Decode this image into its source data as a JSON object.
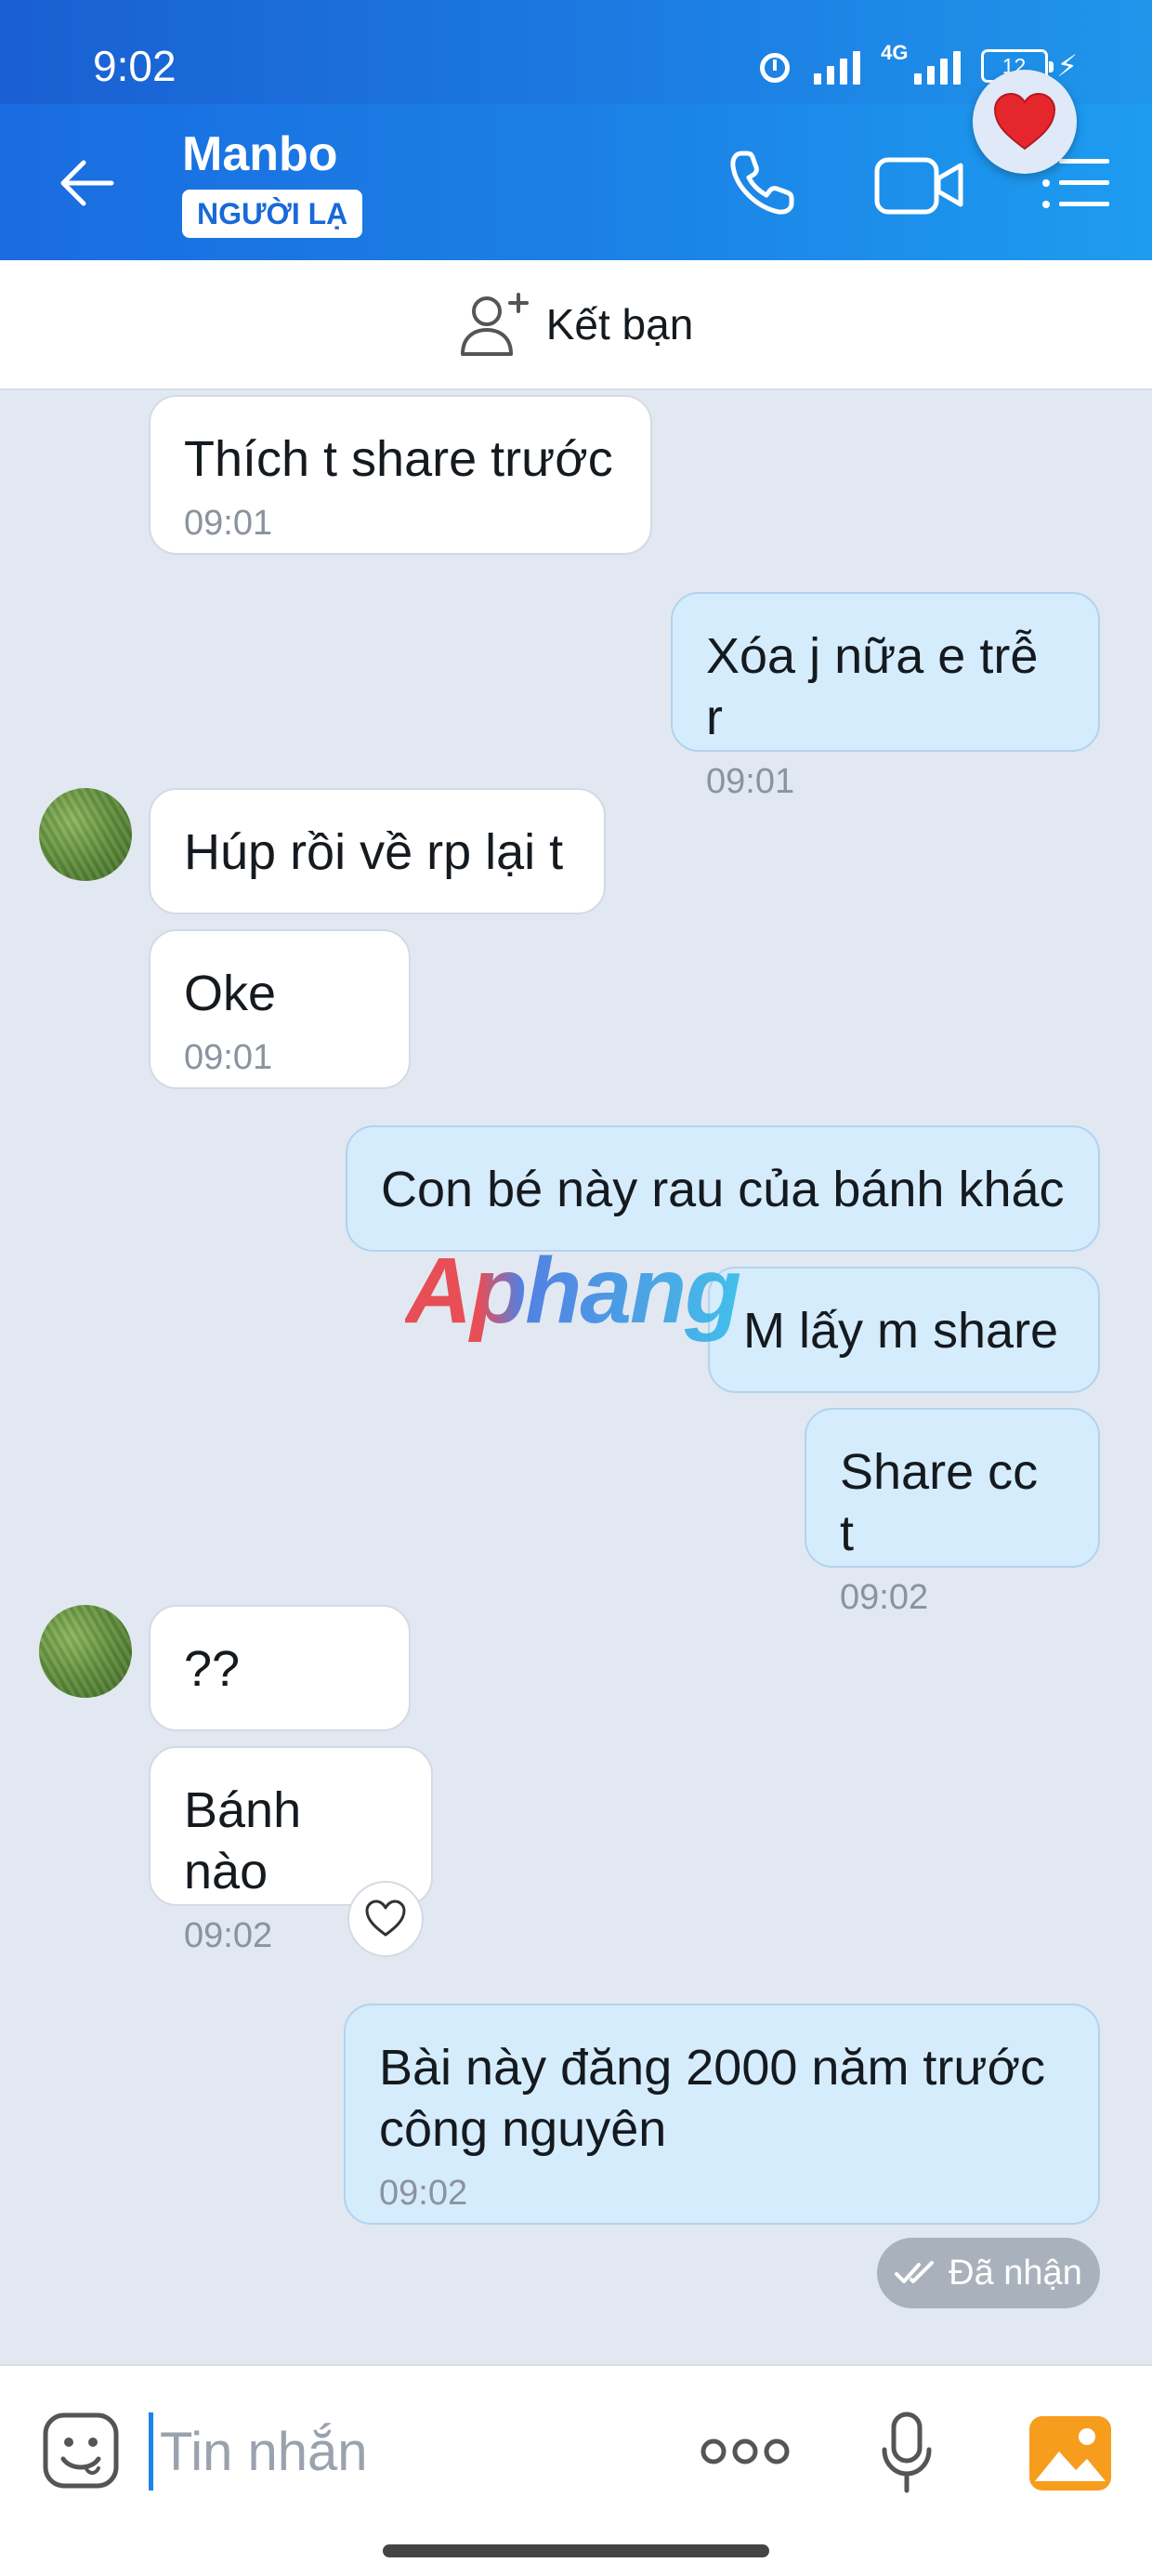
{
  "status_bar": {
    "time": "9:02",
    "network": "4G",
    "battery": "12"
  },
  "header": {
    "name": "Manbo",
    "badge": "NGƯỜI LẠ"
  },
  "add_friend": {
    "label": "Kết bạn"
  },
  "messages": [
    {
      "side": "in",
      "text": "Thích t share trước",
      "time": "09:01"
    },
    {
      "side": "out",
      "text": "Xóa j nữa e trễ r",
      "time": "09:01"
    },
    {
      "side": "in",
      "text": "Húp rồi về rp lại t",
      "time": ""
    },
    {
      "side": "in",
      "text": "Oke",
      "time": "09:01"
    },
    {
      "side": "out",
      "text": "Con bé này rau của bánh khác",
      "time": ""
    },
    {
      "side": "out",
      "text": "M lấy m share",
      "time": ""
    },
    {
      "side": "out",
      "text": "Share cc t",
      "time": "09:02"
    },
    {
      "side": "in",
      "text": "??",
      "time": ""
    },
    {
      "side": "in",
      "text": "Bánh nào",
      "time": "09:02"
    },
    {
      "side": "out",
      "text": "Bài này đăng 2000 năm trước công nguyên",
      "time": "09:02"
    }
  ],
  "watermark": "Aphang",
  "status_badge": "Đã nhận",
  "composer": {
    "placeholder": "Tin nhắn"
  },
  "colors": {
    "header_blue": "#1b82e6",
    "outgoing_bubble": "#d5ecfd",
    "chat_bg": "#e2e8f1"
  }
}
